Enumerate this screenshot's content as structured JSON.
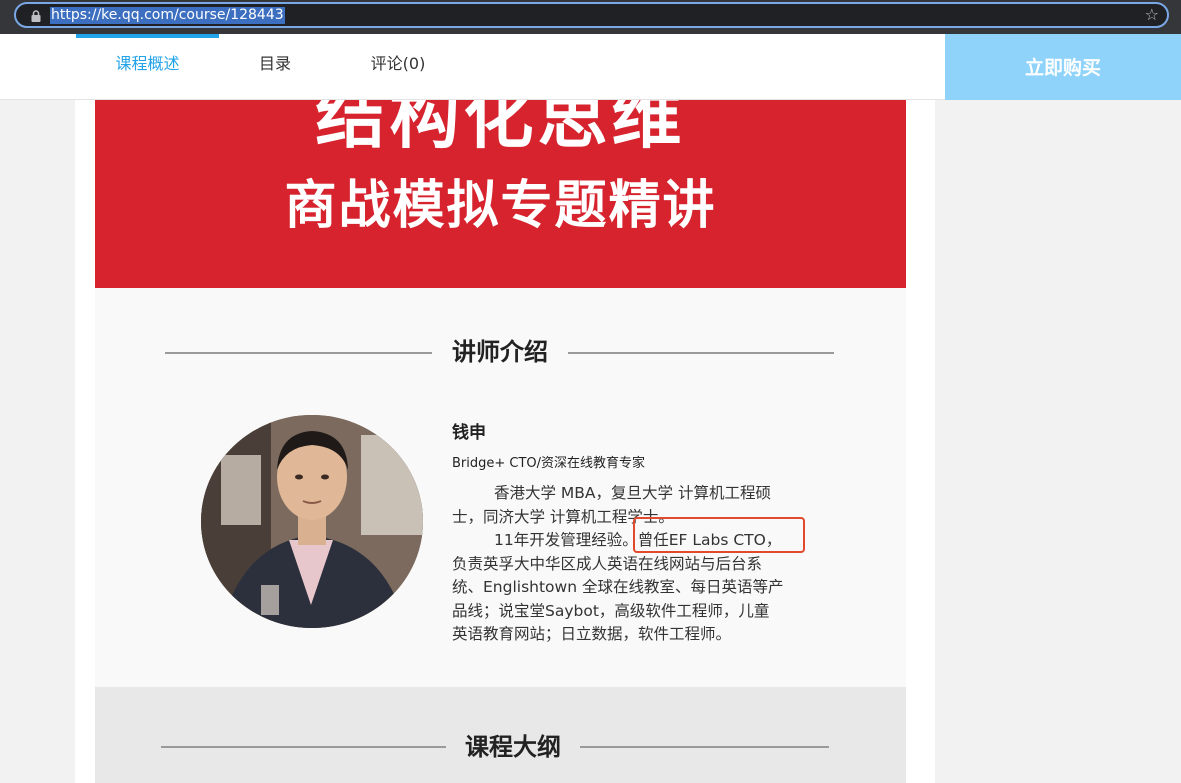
{
  "browser": {
    "url": "https://ke.qq.com/course/128443"
  },
  "nav": {
    "tabs": [
      {
        "label": "课程概述",
        "active": true
      },
      {
        "label": "目录",
        "active": false
      },
      {
        "label": "评论(0)",
        "active": false
      }
    ],
    "buy_label": "立即购买"
  },
  "poster": {
    "title": "结构化思维",
    "subtitle": "商战模拟专题精讲",
    "section_instructor": "讲师介绍",
    "instructor": {
      "name": "钱申",
      "role": "Bridge+ CTO/资深在线教育专家",
      "bio_lines": [
        "香港大学 MBA，复旦大学 计算机工程硕",
        "士，同济大学 计算机工程学士。",
        "11年开发管理经验。曾任EF Labs CTO，",
        "负责英孚大中华区成人英语在线网站与后台系",
        "统、Englishtown 全球在线教室、每日英语等产",
        "品线；说宝堂Saybot，高级软件工程师，儿童",
        "英语教育网站；日立数据，软件工程师。"
      ]
    },
    "section_outline": "课程大纲"
  },
  "colors": {
    "accent": "#23a3e8",
    "buy_button": "#8fd3fb",
    "banner": "#d6232e",
    "highlight": "#e2492d"
  }
}
